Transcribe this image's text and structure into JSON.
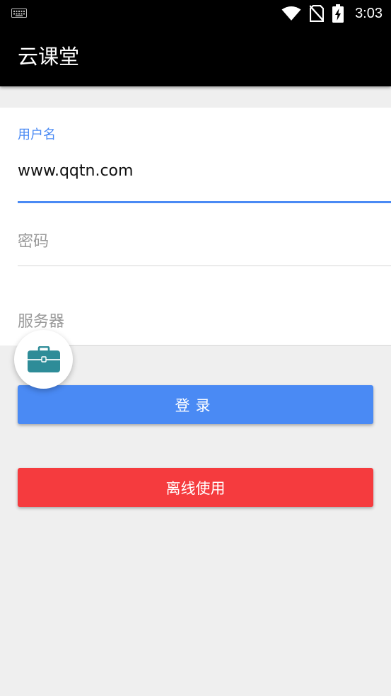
{
  "status_bar": {
    "time": "3:03",
    "icons": [
      "keyboard-icon",
      "wifi-icon",
      "no-sim-icon",
      "battery-charging-icon"
    ]
  },
  "app_bar": {
    "title": "云课堂"
  },
  "form": {
    "username": {
      "label": "用户名",
      "value": "www.qqtn.com"
    },
    "password": {
      "placeholder": "密码"
    },
    "server": {
      "placeholder": "服务器"
    }
  },
  "fab": {
    "icon": "briefcase-icon"
  },
  "buttons": {
    "login_label": "登录",
    "offline_label": "离线使用"
  },
  "colors": {
    "accent": "#4a8af4",
    "login_button": "#4a8af4",
    "offline_button": "#f53b3e",
    "fab_icon": "#2e8c98",
    "app_bar": "#000000",
    "background": "#efefef"
  }
}
